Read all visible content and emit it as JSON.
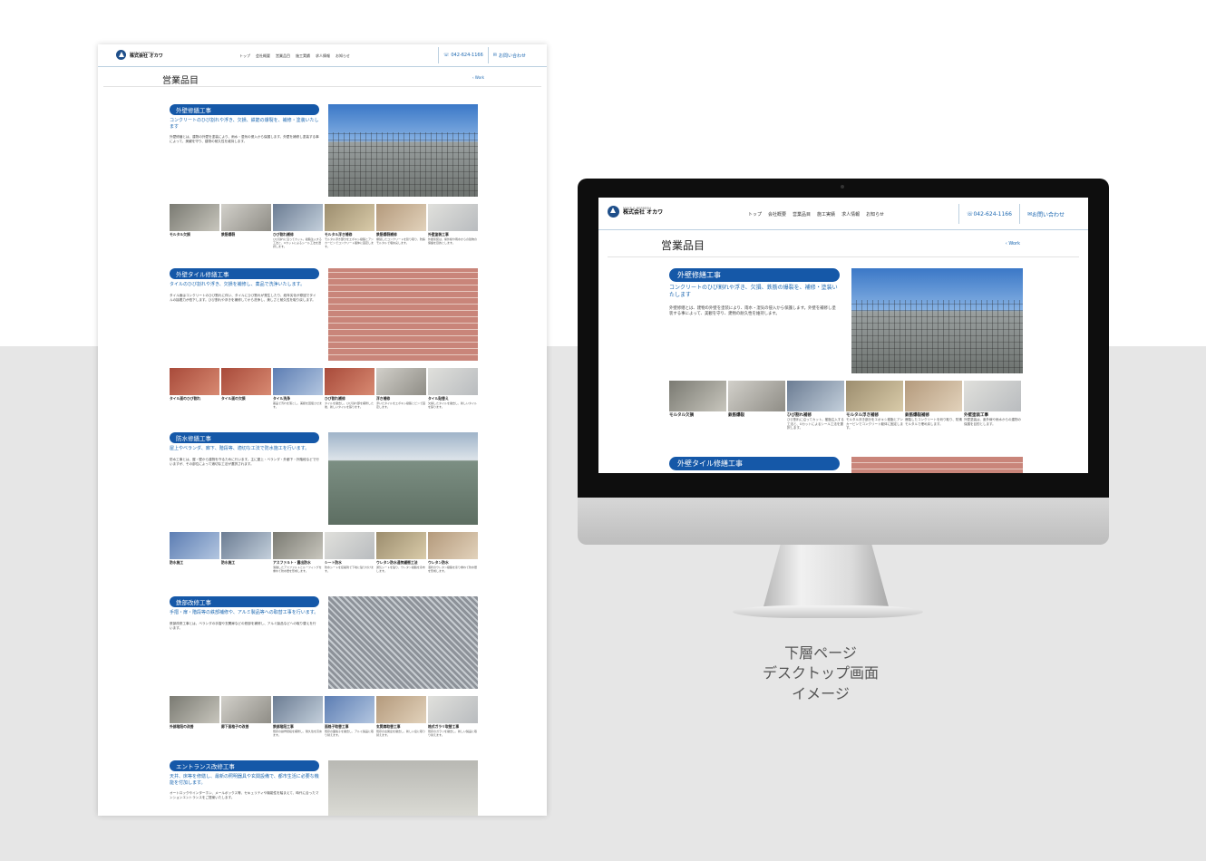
{
  "site": {
    "logo_small": "MAKE & REFRESH",
    "logo_name": "株式会社 オカワ",
    "nav": [
      "トップ",
      "会社概要",
      "営業品目",
      "施工実績",
      "求人情報",
      "お知らせ"
    ],
    "phone": "042-624-1166",
    "contact": "お問い合わせ",
    "page_title": "営業品目",
    "breadcrumb": "‹ Work"
  },
  "sections": [
    {
      "title": "外壁修繕工事",
      "lead": "コンクリートのひび割れや浮き、欠損、鉄筋の爆裂を、補修・塗装いたします",
      "body": "外壁修繕とは、建物の外壁を塗装により、雨水・湿気の侵入から保護します。外壁を補修し塗装する事によって、美観を守り、建物の耐久性を維持します。",
      "img": "scaffold",
      "thumbs": [
        {
          "label": "モルタル欠損",
          "desc": "",
          "c": "g1"
        },
        {
          "label": "鉄筋爆裂",
          "desc": "",
          "c": "g2"
        },
        {
          "label": "ひび割れ補修",
          "desc": "ひび割れに沿ってカット。樹脂注入する工法と、Uカットによるシール工法を選択します。",
          "c": "g3"
        },
        {
          "label": "モルタル浮き補修",
          "desc": "モルタル浮き部分をエポキシ樹脂とアンカーピンでコンクリート躯体に固定します。",
          "c": "g4"
        },
        {
          "label": "鉄筋爆裂補修",
          "desc": "爆裂したコンクリートを斫り取り、防錆モルタルで埋め戻します。",
          "c": "g5"
        },
        {
          "label": "外壁塗装工事",
          "desc": "外壁塗装は、紫外線や雨水からの建物の保護を目的とします。",
          "c": "g6"
        }
      ]
    },
    {
      "title": "外壁タイル修繕工事",
      "lead": "タイルのひび割れや浮き、欠損を補修し、薬品で洗浄いたします。",
      "body": "タイル面はコンクリートのひび割れに伴い、タイルにひび割れが発生したり、経年劣化が原因でタイルの接着力が低下します。ひび割れや浮きを補修してから洗浄し、美しさと耐久性を取り戻します。",
      "img": "tile",
      "thumbs": [
        {
          "label": "タイル面のひび割れ",
          "desc": "",
          "c": "g7"
        },
        {
          "label": "タイル面の欠損",
          "desc": "",
          "c": "g7"
        },
        {
          "label": "タイル洗浄",
          "desc": "薬品で汚れを落とし、美観を回復させます。",
          "c": "g8"
        },
        {
          "label": "ひび割れ補修",
          "desc": "タイルを撤去し、ひび割れ部を補修した後、新しいタイルを張ります。",
          "c": "g7"
        },
        {
          "label": "浮き補修",
          "desc": "浮いたタイルをエポキシ樹脂とピンで固定します。",
          "c": "g2"
        },
        {
          "label": "タイル貼替え",
          "desc": "欠損したタイルを撤去し、新しいタイルを張ります。",
          "c": "g6"
        }
      ]
    },
    {
      "title": "防水修繕工事",
      "lead": "屋上やベランダ、廊下、階段等、適切な工法で防水施工を行います。",
      "body": "防水工事とは、屋・壁から建物を守るために行います。主に屋上・ベランダ・外廊下・外階段などで行いますが、その部位によって適切な工法が選択されます。",
      "img": "roof",
      "thumbs": [
        {
          "label": "防水施工",
          "desc": "",
          "c": "g8"
        },
        {
          "label": "防水施工",
          "desc": "",
          "c": "g3"
        },
        {
          "label": "アスファルト・露出防水",
          "desc": "溶融したアスファルトとルーフィングを重ねて防水層を形成します。",
          "c": "g1"
        },
        {
          "label": "シート防水",
          "desc": "防水シートを接着剤で下地に貼り付けます。",
          "c": "g6"
        },
        {
          "label": "ウレタン防水通気緩衝工法",
          "desc": "通気シートを貼り、ウレタン樹脂を塗布します。",
          "c": "g4"
        },
        {
          "label": "ウレタン防水",
          "desc": "液状のウレタン樹脂を塗り重ねて防水層を形成します。",
          "c": "g5"
        }
      ]
    },
    {
      "title": "鉄部改修工事",
      "lead": "手摺・扉・階段等の鉄部補修や、アルミ製品等への取替工事を行います。",
      "body": "鉄部改修工事とは、ベランダの手摺や玄関扉などの鉄部を補修し、アルミ製品などへの取り替えを行います。",
      "img": "metal",
      "thumbs": [
        {
          "label": "外部階段の改善",
          "desc": "",
          "c": "g1"
        },
        {
          "label": "廊下面格子の改善",
          "desc": "",
          "c": "g2"
        },
        {
          "label": "鉄部階段工事",
          "desc": "既存の鉄骨階段を補修し、耐久性を高めます。",
          "c": "g3"
        },
        {
          "label": "面格子取替工事",
          "desc": "既存の面格子を撤去し、アルミ製品に取り替えます。",
          "c": "g8"
        },
        {
          "label": "玄関扉取替工事",
          "desc": "既存の玄関扉を撤去し、新しい扉に取り替えます。",
          "c": "g5"
        },
        {
          "label": "格式ガラリ取替工事",
          "desc": "既存のガラリを撤去し、新しい製品に取り替えます。",
          "c": "g6"
        }
      ]
    },
    {
      "title": "エントランス改修工事",
      "lead": "天井、床等を修繕し、最新の照明器具や玄関設備で、都市生活に必要な機能を付加します。",
      "body": "オートロックやインターホン、メールボックス等、セキュリティや機能性を踏まえて、時代に合ったマンションエントランスをご提案いたします。",
      "img": "worker",
      "thumbs": []
    }
  ],
  "caption": [
    "下層ページ",
    "デスクトップ画面",
    "イメージ"
  ]
}
